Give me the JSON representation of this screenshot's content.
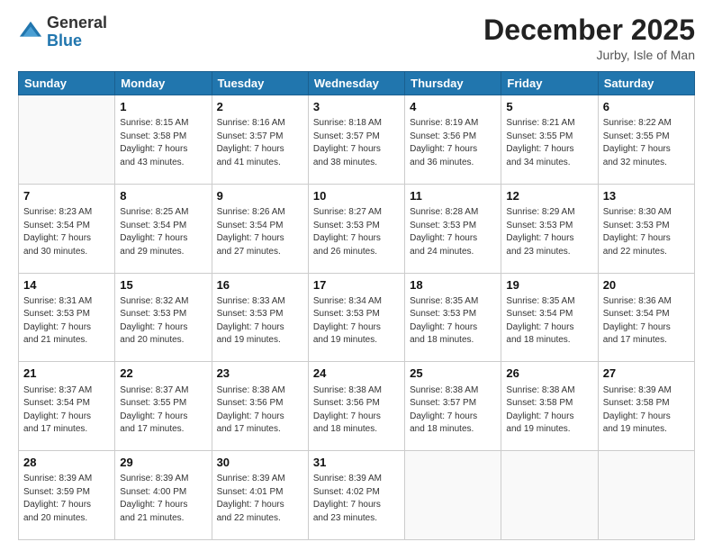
{
  "header": {
    "logo_line1": "General",
    "logo_line2": "Blue",
    "month_title": "December 2025",
    "location": "Jurby, Isle of Man"
  },
  "weekdays": [
    "Sunday",
    "Monday",
    "Tuesday",
    "Wednesday",
    "Thursday",
    "Friday",
    "Saturday"
  ],
  "weeks": [
    [
      {
        "day": "",
        "info": ""
      },
      {
        "day": "1",
        "info": "Sunrise: 8:15 AM\nSunset: 3:58 PM\nDaylight: 7 hours\nand 43 minutes."
      },
      {
        "day": "2",
        "info": "Sunrise: 8:16 AM\nSunset: 3:57 PM\nDaylight: 7 hours\nand 41 minutes."
      },
      {
        "day": "3",
        "info": "Sunrise: 8:18 AM\nSunset: 3:57 PM\nDaylight: 7 hours\nand 38 minutes."
      },
      {
        "day": "4",
        "info": "Sunrise: 8:19 AM\nSunset: 3:56 PM\nDaylight: 7 hours\nand 36 minutes."
      },
      {
        "day": "5",
        "info": "Sunrise: 8:21 AM\nSunset: 3:55 PM\nDaylight: 7 hours\nand 34 minutes."
      },
      {
        "day": "6",
        "info": "Sunrise: 8:22 AM\nSunset: 3:55 PM\nDaylight: 7 hours\nand 32 minutes."
      }
    ],
    [
      {
        "day": "7",
        "info": "Sunrise: 8:23 AM\nSunset: 3:54 PM\nDaylight: 7 hours\nand 30 minutes."
      },
      {
        "day": "8",
        "info": "Sunrise: 8:25 AM\nSunset: 3:54 PM\nDaylight: 7 hours\nand 29 minutes."
      },
      {
        "day": "9",
        "info": "Sunrise: 8:26 AM\nSunset: 3:54 PM\nDaylight: 7 hours\nand 27 minutes."
      },
      {
        "day": "10",
        "info": "Sunrise: 8:27 AM\nSunset: 3:53 PM\nDaylight: 7 hours\nand 26 minutes."
      },
      {
        "day": "11",
        "info": "Sunrise: 8:28 AM\nSunset: 3:53 PM\nDaylight: 7 hours\nand 24 minutes."
      },
      {
        "day": "12",
        "info": "Sunrise: 8:29 AM\nSunset: 3:53 PM\nDaylight: 7 hours\nand 23 minutes."
      },
      {
        "day": "13",
        "info": "Sunrise: 8:30 AM\nSunset: 3:53 PM\nDaylight: 7 hours\nand 22 minutes."
      }
    ],
    [
      {
        "day": "14",
        "info": "Sunrise: 8:31 AM\nSunset: 3:53 PM\nDaylight: 7 hours\nand 21 minutes."
      },
      {
        "day": "15",
        "info": "Sunrise: 8:32 AM\nSunset: 3:53 PM\nDaylight: 7 hours\nand 20 minutes."
      },
      {
        "day": "16",
        "info": "Sunrise: 8:33 AM\nSunset: 3:53 PM\nDaylight: 7 hours\nand 19 minutes."
      },
      {
        "day": "17",
        "info": "Sunrise: 8:34 AM\nSunset: 3:53 PM\nDaylight: 7 hours\nand 19 minutes."
      },
      {
        "day": "18",
        "info": "Sunrise: 8:35 AM\nSunset: 3:53 PM\nDaylight: 7 hours\nand 18 minutes."
      },
      {
        "day": "19",
        "info": "Sunrise: 8:35 AM\nSunset: 3:54 PM\nDaylight: 7 hours\nand 18 minutes."
      },
      {
        "day": "20",
        "info": "Sunrise: 8:36 AM\nSunset: 3:54 PM\nDaylight: 7 hours\nand 17 minutes."
      }
    ],
    [
      {
        "day": "21",
        "info": "Sunrise: 8:37 AM\nSunset: 3:54 PM\nDaylight: 7 hours\nand 17 minutes."
      },
      {
        "day": "22",
        "info": "Sunrise: 8:37 AM\nSunset: 3:55 PM\nDaylight: 7 hours\nand 17 minutes."
      },
      {
        "day": "23",
        "info": "Sunrise: 8:38 AM\nSunset: 3:56 PM\nDaylight: 7 hours\nand 17 minutes."
      },
      {
        "day": "24",
        "info": "Sunrise: 8:38 AM\nSunset: 3:56 PM\nDaylight: 7 hours\nand 18 minutes."
      },
      {
        "day": "25",
        "info": "Sunrise: 8:38 AM\nSunset: 3:57 PM\nDaylight: 7 hours\nand 18 minutes."
      },
      {
        "day": "26",
        "info": "Sunrise: 8:38 AM\nSunset: 3:58 PM\nDaylight: 7 hours\nand 19 minutes."
      },
      {
        "day": "27",
        "info": "Sunrise: 8:39 AM\nSunset: 3:58 PM\nDaylight: 7 hours\nand 19 minutes."
      }
    ],
    [
      {
        "day": "28",
        "info": "Sunrise: 8:39 AM\nSunset: 3:59 PM\nDaylight: 7 hours\nand 20 minutes."
      },
      {
        "day": "29",
        "info": "Sunrise: 8:39 AM\nSunset: 4:00 PM\nDaylight: 7 hours\nand 21 minutes."
      },
      {
        "day": "30",
        "info": "Sunrise: 8:39 AM\nSunset: 4:01 PM\nDaylight: 7 hours\nand 22 minutes."
      },
      {
        "day": "31",
        "info": "Sunrise: 8:39 AM\nSunset: 4:02 PM\nDaylight: 7 hours\nand 23 minutes."
      },
      {
        "day": "",
        "info": ""
      },
      {
        "day": "",
        "info": ""
      },
      {
        "day": "",
        "info": ""
      }
    ]
  ]
}
